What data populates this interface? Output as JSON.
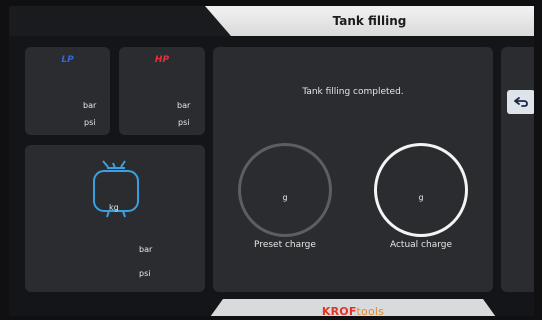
{
  "header": {
    "title": "Tank filling"
  },
  "lp_gauge": {
    "label": "LP",
    "unit_bar": "bar",
    "unit_psi": "psi"
  },
  "hp_gauge": {
    "label": "HP",
    "unit_bar": "bar",
    "unit_psi": "psi"
  },
  "scale": {
    "weight_unit": "kg",
    "unit_bar": "bar",
    "unit_psi": "psi"
  },
  "main": {
    "status": "Tank filling completed.",
    "preset": {
      "unit": "g",
      "label": "Preset charge"
    },
    "actual": {
      "unit": "g",
      "label": "Actual charge"
    }
  },
  "footer": {
    "brand_part1": "KROF",
    "brand_part2": "tools"
  },
  "icons": {
    "back": "back-arrow-icon",
    "scale": "scale-icon"
  },
  "colors": {
    "lp": "#2d6ad8",
    "hp": "#e2333b",
    "scale": "#3aa0e0"
  }
}
